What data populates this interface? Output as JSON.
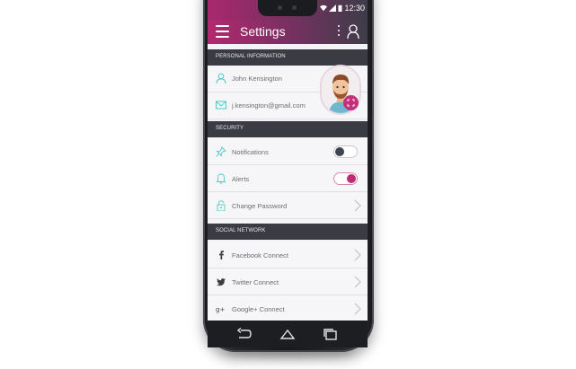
{
  "status_bar": {
    "time": "12:30"
  },
  "header": {
    "title": "Settings",
    "menu_icon": "hamburger-menu-icon",
    "more_icon": "more-vertical-icon",
    "profile_icon": "user-icon"
  },
  "colors": {
    "header_gradient_start": "#b3296f",
    "header_gradient_end": "#3e3d49",
    "section_header": "#3b3c43",
    "icon_accent": "#4fc9c6",
    "toggle_on": "#c02b73",
    "toggle_off": "#3e4550"
  },
  "personal": {
    "header": "PERSONAL INFORMATION",
    "name": "John Kensington",
    "email": "j.kensington@gmail.com",
    "name_icon": "person-icon",
    "email_icon": "envelope-icon",
    "avatar_icon": "avatar-illustration",
    "edit_icon": "expand-icon"
  },
  "security": {
    "header": "SECURITY",
    "notifications_label": "Notifications",
    "notifications_on": false,
    "alerts_label": "Alerts",
    "alerts_on": true,
    "change_password_label": "Change Password"
  },
  "social": {
    "header": "SOCIAL NETWORK",
    "facebook_label": "Facebook Connect",
    "twitter_label": "Twitter Connect",
    "google_label": "Google+ Connect"
  },
  "navigation_bar": {
    "back_icon": "back-arrow-icon",
    "home_icon": "home-icon",
    "recents_icon": "recent-apps-icon"
  }
}
